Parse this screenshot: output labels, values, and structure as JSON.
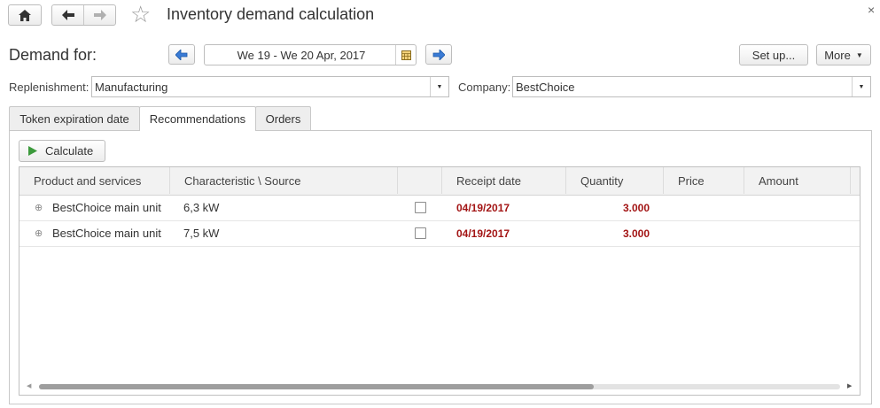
{
  "window": {
    "title": "Inventory demand calculation",
    "close_glyph": "×"
  },
  "toolbar": {
    "home_icon": "home-icon",
    "back_icon": "arrow-left-icon",
    "forward_icon": "arrow-right-icon",
    "star_glyph": "☆"
  },
  "header": {
    "demand_label": "Demand for:",
    "period_value": "We 19 - We 20 Apr, 2017",
    "setup_label": "Set up...",
    "more_label": "More"
  },
  "filters": {
    "replenishment_label": "Replenishment:",
    "replenishment_value": "Manufacturing",
    "company_label": "Company:",
    "company_value": "BestChoice"
  },
  "tabs": [
    {
      "label": "Token expiration date",
      "active": false
    },
    {
      "label": "Recommendations",
      "active": true
    },
    {
      "label": "Orders",
      "active": false
    }
  ],
  "actions": {
    "calculate_label": "Calculate"
  },
  "table": {
    "columns": [
      "Product and services",
      "Characteristic \\ Source",
      "",
      "Receipt date",
      "Quantity",
      "Price",
      "Amount"
    ],
    "rows": [
      {
        "product": "BestChoice main unit",
        "characteristic": "6,3 kW",
        "checked": false,
        "receipt_date": "04/19/2017",
        "quantity": "3.000",
        "price": "",
        "amount": ""
      },
      {
        "product": "BestChoice main unit",
        "characteristic": "7,5 kW",
        "checked": false,
        "receipt_date": "04/19/2017",
        "quantity": "3.000",
        "price": "",
        "amount": ""
      }
    ],
    "expand_glyph": "⊕"
  },
  "colors": {
    "accent_red": "#a31515",
    "nav_arrow_blue": "#3a7bd5",
    "play_green": "#3c9a3c"
  }
}
